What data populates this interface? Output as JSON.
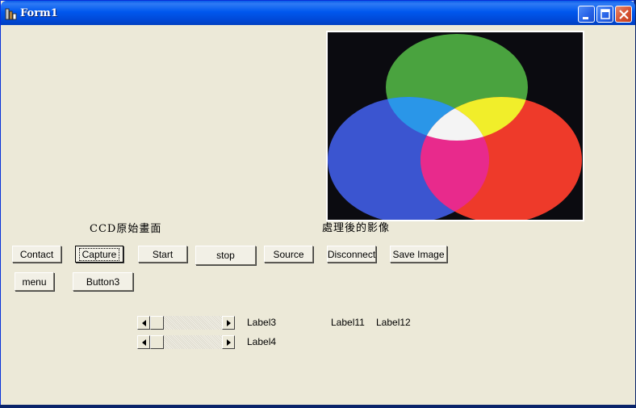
{
  "window": {
    "title": "Form1"
  },
  "captions": {
    "ccd_original": "CCD原始畫面",
    "processed_image": "處理後的影像"
  },
  "buttons": {
    "contact": "Contact",
    "capture": "Capture",
    "start": "Start",
    "stop": "stop",
    "source": "Source",
    "disconnect": "Disconnect",
    "save_image": "Save Image",
    "menu": "menu",
    "button3": "Button3"
  },
  "labels": {
    "label3": "Label3",
    "label4": "Label4",
    "label11": "Label11",
    "label12": "Label12"
  },
  "colors": {
    "title_bar": "#0058ee",
    "form_background": "#ece9d8",
    "close_button": "#d65232"
  },
  "icons": {
    "app": "form-app-icon",
    "minimize": "minimize-icon",
    "maximize": "maximize-icon",
    "close": "close-icon",
    "scroll_left": "arrow-left-icon",
    "scroll_right": "arrow-right-icon"
  },
  "scrollbars": {
    "scrollbar1_position": 0,
    "scrollbar2_position": 0
  }
}
